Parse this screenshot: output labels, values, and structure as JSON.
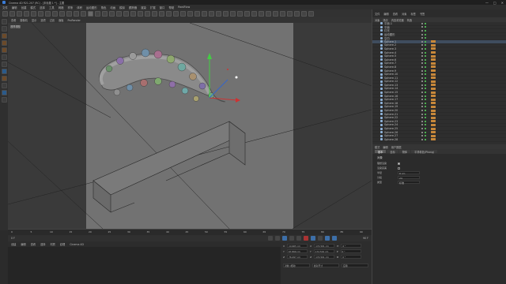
{
  "window": {
    "title": "Cinema 4D R21.207 (RC) - [未标题 1 *] - 主要",
    "controls": [
      "—",
      "□",
      "✕"
    ]
  },
  "menubar": {
    "items": [
      "文件",
      "编辑",
      "创建",
      "模式",
      "选择",
      "工具",
      "网格",
      "样条",
      "体积",
      "运动图形",
      "角色",
      "动画",
      "模拟",
      "跟踪器",
      "渲染",
      "扩展",
      "窗口",
      "帮助",
      "RealFlow"
    ]
  },
  "toolbar": {
    "buttons": 44
  },
  "viewport": {
    "header_items": [
      "查看",
      "摄像机",
      "显示",
      "选项",
      "过滤",
      "面板",
      "ProRender"
    ],
    "label": "透视视图",
    "colors": {
      "background": "#3a3a3a",
      "render_region": "#727272"
    }
  },
  "timeline": {
    "ticks": [
      "0",
      "5",
      "10",
      "15",
      "20",
      "25",
      "30",
      "35",
      "40",
      "45",
      "50",
      "55",
      "60",
      "65",
      "70",
      "75",
      "80",
      "85",
      "90"
    ],
    "end": "90 F",
    "current": "0 F"
  },
  "material_manager": {
    "menu": [
      "创建",
      "编辑",
      "查看",
      "选择",
      "材质",
      "纹理",
      "Cinema 4D"
    ]
  },
  "coordinates": {
    "rows": [
      {
        "l1": "X",
        "v1": "14.965 cm",
        "l2": "X",
        "v2": "172.501 cm",
        "l3": "H",
        "v3": "0 °"
      },
      {
        "l1": "Y",
        "v1": "67.869 cm",
        "l2": "Y",
        "v2": "172.501 cm",
        "l3": "P",
        "v3": "0 °"
      },
      {
        "l1": "Z",
        "v1": "76.497 cm",
        "l2": "Z",
        "v2": "172.501 cm",
        "l3": "B",
        "v3": "0 °"
      }
    ],
    "mode": "对象 (相对)",
    "size_mode": "绝对尺寸",
    "apply": "应用"
  },
  "object_manager": {
    "header": [
      "文件",
      "编辑",
      "查看",
      "对象",
      "标签",
      "书签"
    ],
    "tabs": [
      "对象",
      "场次",
      "内容浏览器",
      "构造"
    ],
    "objects": [
      {
        "name": "平面.1",
        "tag": false,
        "sel": false
      },
      {
        "name": "平面",
        "tag": false,
        "sel": false
      },
      {
        "name": "灯光",
        "tag": false,
        "sel": false
      },
      {
        "name": "运动图形",
        "tag": false,
        "sel": false
      },
      {
        "name": "空白",
        "tag": false,
        "sel": false
      },
      {
        "name": "Sphere.1",
        "tag": true,
        "sel": true
      },
      {
        "name": "Sphere.2",
        "tag": true,
        "sel": false
      },
      {
        "name": "Sphere.3",
        "tag": true,
        "sel": false
      },
      {
        "name": "Sphere.4",
        "tag": true,
        "sel": false
      },
      {
        "name": "Sphere.5",
        "tag": true,
        "sel": false
      },
      {
        "name": "Sphere.6",
        "tag": true,
        "sel": false
      },
      {
        "name": "Sphere.7",
        "tag": true,
        "sel": false
      },
      {
        "name": "Sphere.8",
        "tag": true,
        "sel": false
      },
      {
        "name": "Sphere.9",
        "tag": true,
        "sel": false
      },
      {
        "name": "Sphere.10",
        "tag": true,
        "sel": false
      },
      {
        "name": "Sphere.11",
        "tag": true,
        "sel": false
      },
      {
        "name": "Sphere.12",
        "tag": true,
        "sel": false
      },
      {
        "name": "Sphere.13",
        "tag": true,
        "sel": false
      },
      {
        "name": "Sphere.14",
        "tag": true,
        "sel": false
      },
      {
        "name": "Sphere.15",
        "tag": true,
        "sel": false
      },
      {
        "name": "Sphere.16",
        "tag": true,
        "sel": false
      },
      {
        "name": "Sphere.17",
        "tag": true,
        "sel": false
      },
      {
        "name": "Sphere.18",
        "tag": true,
        "sel": false
      },
      {
        "name": "Sphere.19",
        "tag": true,
        "sel": false
      },
      {
        "name": "Sphere.20",
        "tag": true,
        "sel": false
      },
      {
        "name": "Sphere.21",
        "tag": true,
        "sel": false
      },
      {
        "name": "Sphere.22",
        "tag": true,
        "sel": false
      },
      {
        "name": "Sphere.23",
        "tag": true,
        "sel": false
      },
      {
        "name": "Sphere.24",
        "tag": true,
        "sel": false
      },
      {
        "name": "Sphere.25",
        "tag": true,
        "sel": false
      },
      {
        "name": "Sphere.26",
        "tag": true,
        "sel": false
      },
      {
        "name": "Sphere.27",
        "tag": true,
        "sel": false
      },
      {
        "name": "Sphere.28",
        "tag": true,
        "sel": false
      }
    ]
  },
  "attributes": {
    "header": [
      "模式",
      "编辑",
      "用户数据"
    ],
    "tabs": [
      "基本",
      "坐标",
      "物体",
      "平滑着色(Phong)"
    ],
    "title": "对象",
    "fields": [
      {
        "label": "半径",
        "value": "8 cm"
      },
      {
        "label": "分段",
        "value": "24"
      },
      {
        "label": "类型",
        "value": "标准"
      }
    ],
    "checks": [
      {
        "label": "理想渲染",
        "on": true
      },
      {
        "label": "渲染完美",
        "on": false
      }
    ]
  }
}
